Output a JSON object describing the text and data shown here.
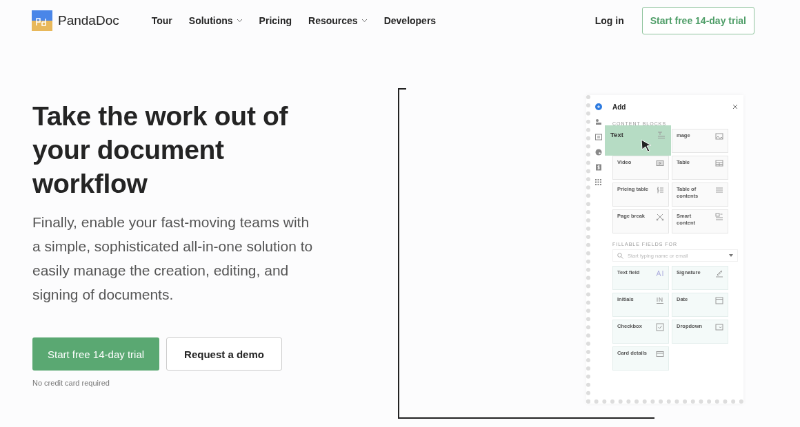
{
  "nav": {
    "logo": "PandaDoc",
    "links": [
      {
        "label": "Tour",
        "dropdown": false
      },
      {
        "label": "Solutions",
        "dropdown": true
      },
      {
        "label": "Pricing",
        "dropdown": false
      },
      {
        "label": "Resources",
        "dropdown": true
      },
      {
        "label": "Developers",
        "dropdown": false
      }
    ],
    "login": "Log in",
    "cta": "Start free 14-day trial"
  },
  "hero": {
    "heading": "Take the work out of your document workflow",
    "subheading": "Finally, enable your fast-moving teams with a simple, sophisticated all-in-one solution to easily manage the creation, editing, and signing of documents.",
    "primary_button": "Start free 14-day trial",
    "secondary_button": "Request a demo",
    "note": "No credit card required"
  },
  "editor_panel": {
    "title": "Add",
    "tools": [
      {
        "kind": "add",
        "selected": true
      },
      {
        "kind": "recipients",
        "selected": false
      },
      {
        "kind": "variables",
        "selected": false
      },
      {
        "kind": "design",
        "selected": false
      },
      {
        "kind": "pricing",
        "selected": false
      },
      {
        "kind": "apps",
        "selected": false
      }
    ],
    "content_heading": "CONTENT BLOCKS",
    "content_blocks": [
      {
        "label": "Text",
        "kind": "text",
        "dragging": true
      },
      {
        "label": "mage",
        "kind": "image",
        "dragging": false
      },
      {
        "label": "Video",
        "kind": "video",
        "dragging": false
      },
      {
        "label": "Table",
        "kind": "table",
        "dragging": false
      },
      {
        "label": "Pricing table",
        "kind": "pricing",
        "dragging": false
      },
      {
        "label": "Table of contents",
        "kind": "list",
        "dragging": false
      },
      {
        "label": "Page break",
        "kind": "scissors",
        "dragging": false
      },
      {
        "label": "Smart content",
        "kind": "smart",
        "dragging": false
      }
    ],
    "fields_heading": "FILLABLE FIELDS FOR",
    "search_placeholder": "Start typing name or email",
    "fields": [
      {
        "label": "Text field",
        "kind": "textfield"
      },
      {
        "label": "Signature",
        "kind": "signature"
      },
      {
        "label": "Initials",
        "kind": "initials"
      },
      {
        "label": "Date",
        "kind": "date"
      },
      {
        "label": "Checkbox",
        "kind": "checkbox"
      },
      {
        "label": "Dropdown",
        "kind": "dropdown"
      },
      {
        "label": "Card details",
        "kind": "card"
      }
    ]
  }
}
